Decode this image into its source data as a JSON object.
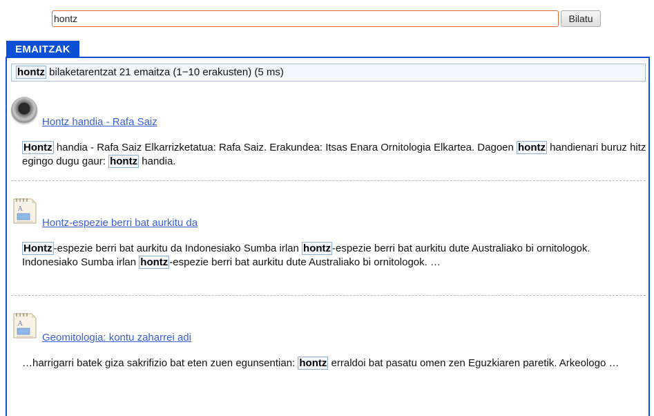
{
  "search": {
    "value": "hontz",
    "button_label": "Bilatu"
  },
  "tab": {
    "label": "EMAITZAK"
  },
  "summary": {
    "term": "hontz",
    "text": " bilaketarentzat 21 emaitza (1−10 erakusten) (5 ms)"
  },
  "results": [
    {
      "icon": "speaker-icon",
      "title": "Hontz handia - Rafa Saiz",
      "snippet": [
        {
          "hl": "Hontz"
        },
        {
          "t": " handia - Rafa Saiz Elkarrizketatua: Rafa Saiz. Erakundea: Itsas Enara Ornitologia Elkartea. Dagoen "
        },
        {
          "hl": "hontz"
        },
        {
          "t": " handienari buruz hitz egingo dugu gaur: "
        },
        {
          "hl": "hontz"
        },
        {
          "t": " handia."
        }
      ]
    },
    {
      "icon": "document-icon",
      "title": "Hontz-espezie berri bat aurkitu da",
      "snippet": [
        {
          "hl": "Hontz"
        },
        {
          "t": "-espezie berri bat aurkitu da Indonesiako Sumba irlan "
        },
        {
          "hl": "hontz"
        },
        {
          "t": "-espezie berri bat aurkitu dute Australiako bi ornitologok. Indonesiako Sumba irlan "
        },
        {
          "hl": "hontz"
        },
        {
          "t": "-espezie berri bat aurkitu dute Australiako bi ornitologok. …"
        }
      ]
    },
    {
      "icon": "document-icon",
      "title": "Geomitologia: kontu zaharrei adi",
      "snippet": [
        {
          "t": "…harrigarri batek giza sakrifizio bat eten zuen egunsentian: "
        },
        {
          "hl": "hontz"
        },
        {
          "t": " erraldoi bat pasatu omen zen Eguzkiaren paretik. Arkeologo …"
        }
      ]
    }
  ],
  "colors": {
    "accent": "#0a4fd6",
    "link": "#3b5fd8",
    "input_border": "#e6653a"
  }
}
